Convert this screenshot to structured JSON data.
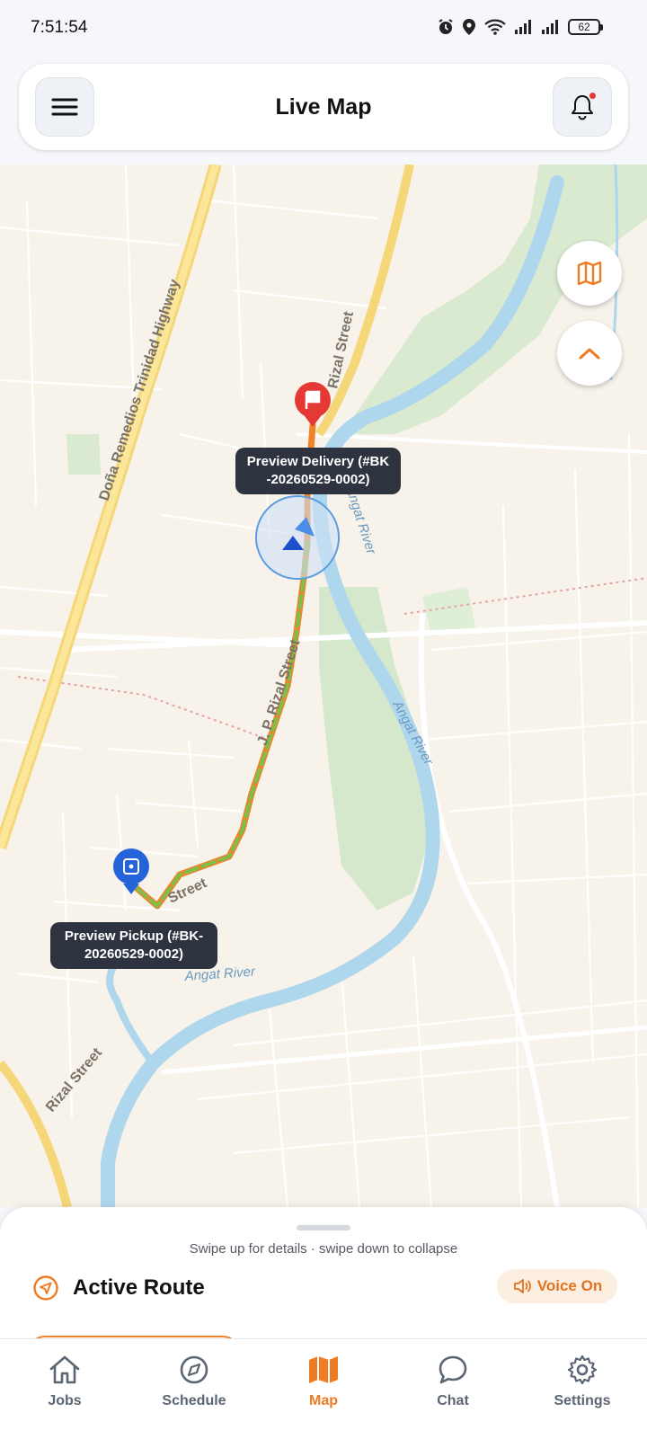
{
  "status_bar": {
    "time": "7:51:54",
    "battery": "62"
  },
  "header": {
    "title": "Live Map"
  },
  "map": {
    "delivery_callout": "Preview Delivery (#BK\n-20260529-0002)",
    "pickup_callout": "Preview Pickup (#BK-\n20260529-0002)",
    "road_labels": [
      "Doña Remedios Trinidad Highway",
      "Rizal Street",
      "J. P. Rizal Street",
      "Street",
      "Rizal Street"
    ],
    "river_labels": [
      "Angat River",
      "Angat River",
      "Angat River"
    ]
  },
  "sheet": {
    "hint": "Swipe up for details · swipe down to collapse",
    "title": "Active Route",
    "voice_label": "Voice On"
  },
  "nav": {
    "items": [
      {
        "label": "Jobs",
        "icon": "home-icon"
      },
      {
        "label": "Schedule",
        "icon": "compass-icon"
      },
      {
        "label": "Map",
        "icon": "map-icon"
      },
      {
        "label": "Chat",
        "icon": "chat-bubble-icon"
      },
      {
        "label": "Settings",
        "icon": "gear-icon"
      }
    ],
    "active": "Map"
  },
  "colors": {
    "accent": "#ef7b22",
    "route_green": "#7cc04b",
    "delivery_red": "#e53935",
    "pickup_blue": "#2563d8",
    "river": "#aed6ec"
  }
}
